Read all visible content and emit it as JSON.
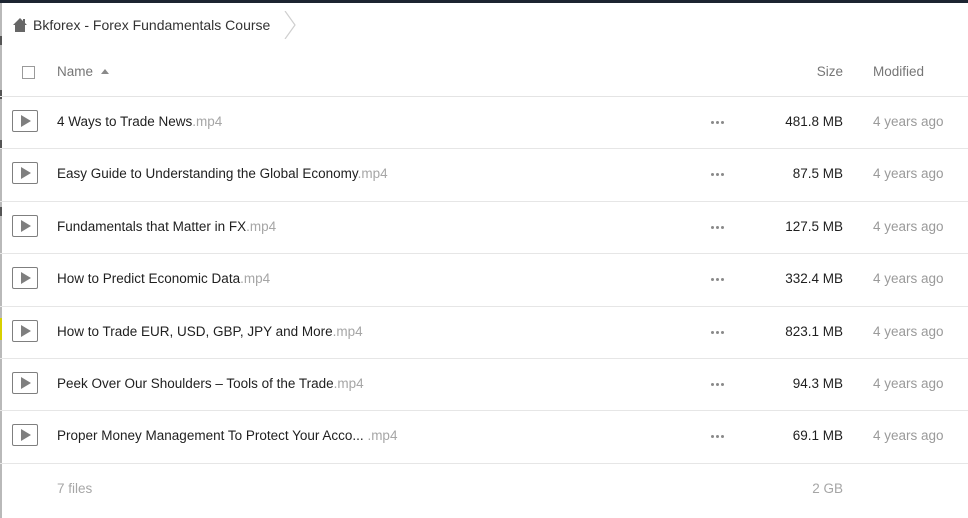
{
  "breadcrumb": {
    "home_icon": "home-icon",
    "title": "Bkforex - Forex Fundamentals Course"
  },
  "table": {
    "columns": {
      "name": "Name",
      "size": "Size",
      "modified": "Modified"
    },
    "sort": {
      "column": "Name",
      "direction": "ascending"
    },
    "rows": [
      {
        "name": "4 Ways to Trade News",
        "ext": ".mp4",
        "size": "481.8 MB",
        "modified": "4 years ago"
      },
      {
        "name": "Easy Guide to Understanding the Global Economy",
        "ext": ".mp4",
        "size": "87.5 MB",
        "modified": "4 years ago"
      },
      {
        "name": "Fundamentals that Matter in FX",
        "ext": ".mp4",
        "size": "127.5 MB",
        "modified": "4 years ago"
      },
      {
        "name": "How to Predict Economic Data",
        "ext": ".mp4",
        "size": "332.4 MB",
        "modified": "4 years ago"
      },
      {
        "name": "How to Trade EUR, USD, GBP, JPY and More",
        "ext": ".mp4",
        "size": "823.1 MB",
        "modified": "4 years ago"
      },
      {
        "name": "Peek Over Our Shoulders – Tools of the Trade",
        "ext": ".mp4",
        "size": "94.3 MB",
        "modified": "4 years ago"
      },
      {
        "name": "Proper Money Management To Protect Your Acco...",
        "ext": " .mp4",
        "size": "69.1 MB",
        "modified": "4 years ago"
      }
    ]
  },
  "footer": {
    "count": "7 files",
    "total": "2 GB"
  },
  "colors": {
    "top_bar": "#1c2431",
    "muted_text": "#a6a6a6",
    "icon_gray": "#7f7f7f"
  }
}
